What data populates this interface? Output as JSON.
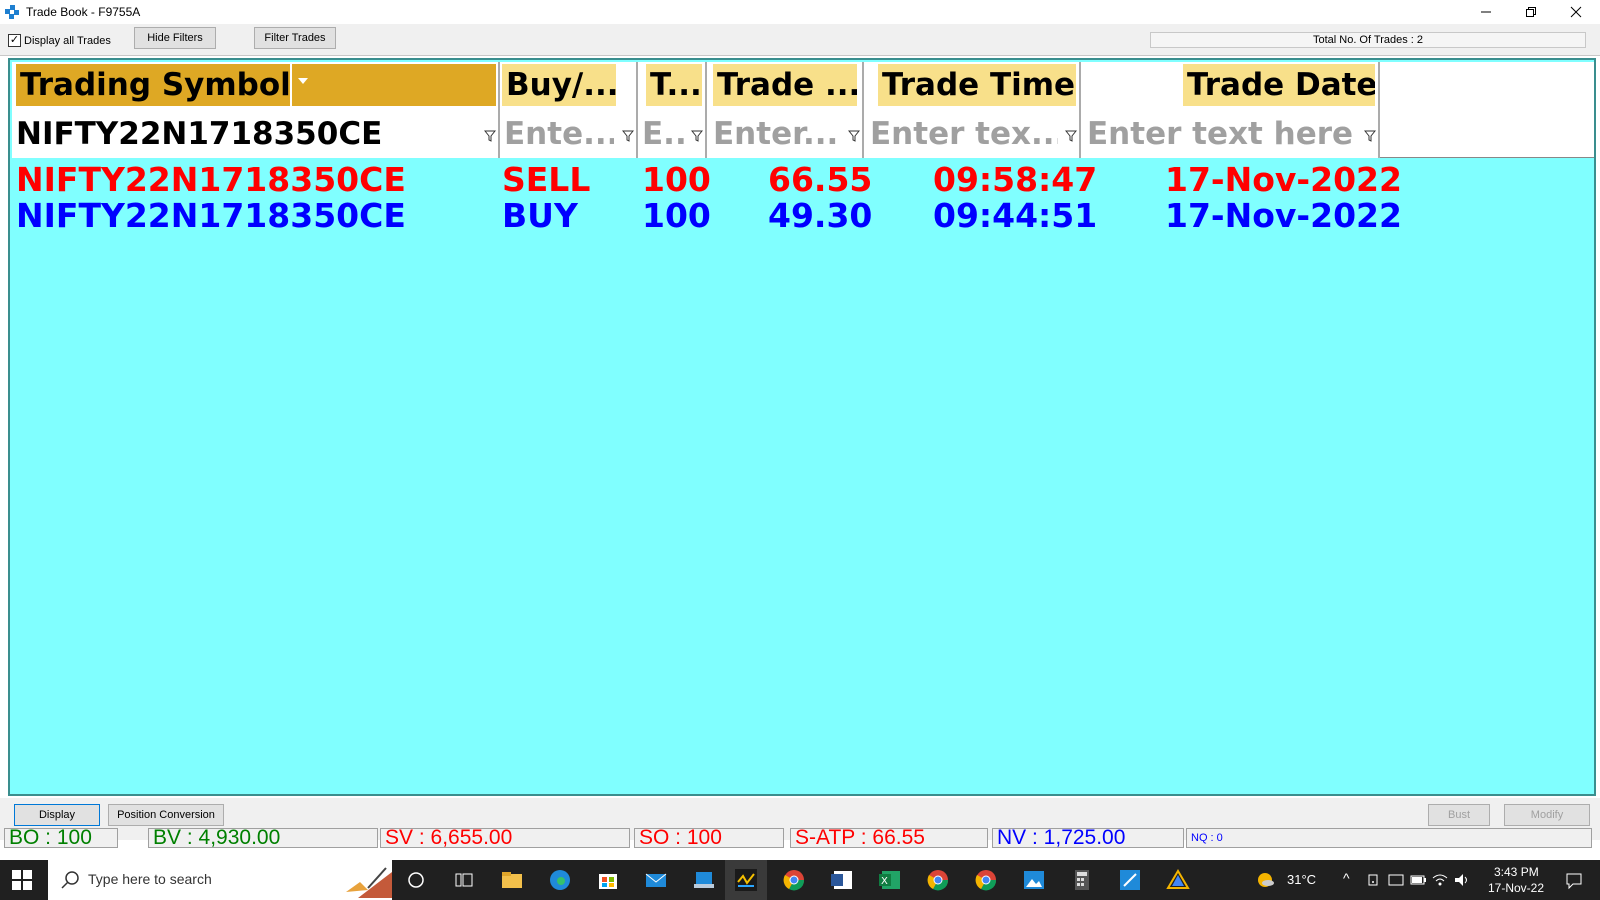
{
  "window": {
    "title": "Trade Book - F9755A"
  },
  "toolbar": {
    "display_all_label": "Display all Trades",
    "display_all_checked": true,
    "hide_filters_label": "Hide Filters",
    "filter_trades_label": "Filter Trades",
    "total_trades": "Total No. Of Trades : 2"
  },
  "grid": {
    "columns": [
      "Trading Symbol",
      "Buy/...",
      "T...",
      "Trade ...",
      "Trade Time",
      "Trade Date"
    ],
    "filters": [
      "NIFTY22N1718350CE",
      "Ente...",
      "E..",
      "Enter...",
      "Enter tex...",
      "Enter text here"
    ],
    "rows": [
      {
        "symbol": "NIFTY22N1718350CE",
        "side": "SELL",
        "qty": "100",
        "price": "66.55",
        "time": "09:58:47",
        "date": "17-Nov-2022",
        "color": "#ff0000"
      },
      {
        "symbol": "NIFTY22N1718350CE",
        "side": "BUY",
        "qty": "100",
        "price": "49.30",
        "time": "09:44:51",
        "date": "17-Nov-2022",
        "color": "#0000ff"
      }
    ],
    "background": "#80ffff",
    "header_color": "#f8e08a",
    "sorted_header_color": "#dea824"
  },
  "bottom": {
    "display_label": "Display",
    "position_conversion_label": "Position Conversion",
    "bust_label": "Bust",
    "modify_label": "Modify",
    "status": {
      "bo": "BO : 100",
      "bv": "BV : 4,930.00",
      "sv": "SV : 6,655.00",
      "so": "SO : 100",
      "satp": "S-ATP : 66.55",
      "nv": "NV : 1,725.00",
      "nq": "NQ : 0"
    }
  },
  "taskbar": {
    "search_placeholder": "Type here to search",
    "weather": "31°C",
    "time": "3:43 PM",
    "date": "17-Nov-22",
    "icons": [
      "windows-start-icon",
      "cortana-icon",
      "task-view-icon",
      "file-explorer-icon",
      "edge-icon",
      "store-icon",
      "mail-icon",
      "app-icon",
      "trading-app-icon",
      "chrome-icon",
      "word-icon",
      "excel-icon",
      "chrome-profile-icon",
      "chrome-profile2-icon",
      "photos-icon",
      "calculator-icon",
      "snipping-icon",
      "drive-icon"
    ]
  }
}
